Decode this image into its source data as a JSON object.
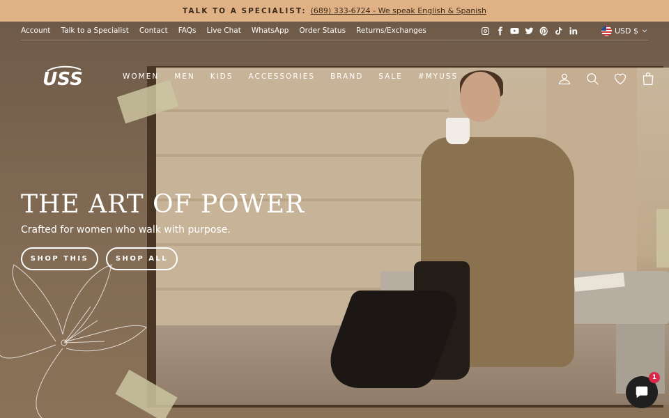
{
  "announcement": {
    "label": "TALK TO A SPECIALIST:",
    "link": "(689) 333-6724 - We speak English & Spanish"
  },
  "utility_nav": {
    "links": [
      "Account",
      "Talk to a Specialist",
      "Contact",
      "FAQs",
      "Live Chat",
      "WhatsApp",
      "Order Status",
      "Returns/Exchanges"
    ],
    "social_icons": [
      "instagram-icon",
      "facebook-icon",
      "youtube-icon",
      "twitter-icon",
      "pinterest-icon",
      "tiktok-icon",
      "linkedin-icon"
    ],
    "currency": "USD $"
  },
  "brand": {
    "logo_text": "USS"
  },
  "main_nav": {
    "items": [
      "WOMEN",
      "MEN",
      "KIDS",
      "ACCESSORIES",
      "BRAND",
      "SALE",
      "#MYUSS"
    ],
    "icons": [
      "account-icon",
      "search-icon",
      "wishlist-icon",
      "cart-icon"
    ]
  },
  "hero": {
    "title": "THE ART OF POWER",
    "subtitle": "Crafted for women who walk with purpose.",
    "buttons": [
      "SHOP THIS",
      "SHOP ALL"
    ]
  },
  "chat": {
    "badge_count": "1"
  },
  "colors": {
    "announcement_bg": "#dfb184",
    "hero_bg": "#7d6650",
    "badge": "#d9284a"
  }
}
